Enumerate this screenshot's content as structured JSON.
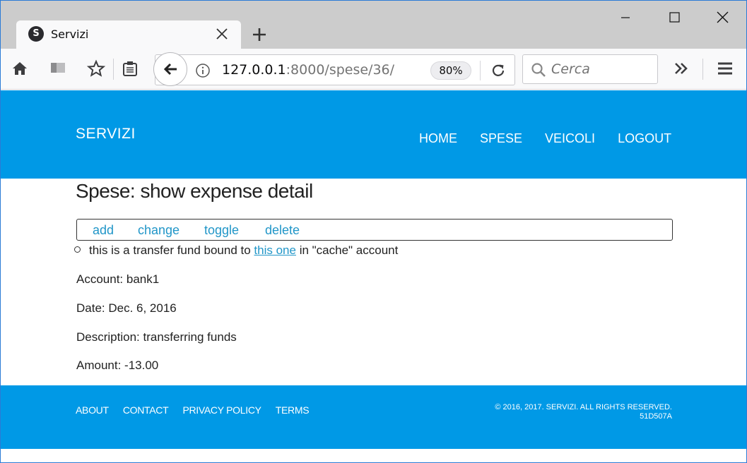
{
  "browser": {
    "tab_title": "Servizi",
    "favicon_letter": "S",
    "url_host": "127.0.0.1",
    "url_rest": ":8000/spese/36/",
    "zoom": "80%",
    "search_placeholder": "Cerca",
    "icons": [
      "home-icon",
      "pocket-icon",
      "bookmark-star-icon",
      "reader-icon",
      "back-arrow-icon",
      "info-icon",
      "reload-icon",
      "search-icon",
      "overflow-icon",
      "hamburger-menu-icon"
    ]
  },
  "header": {
    "brand": "SERVIZI",
    "nav": [
      "HOME",
      "SPESE",
      "VEICOLI",
      "LOGOUT"
    ],
    "color": "#0099e6"
  },
  "main": {
    "title": "Spese: show expense detail",
    "actions": [
      "add",
      "change",
      "toggle",
      "delete"
    ],
    "note_prefix": "this is a transfer fund bound to ",
    "note_link": "this one",
    "note_suffix": " in \"cache\" account",
    "fields": [
      "Account: bank1",
      "Date: Dec. 6, 2016",
      "Description: transferring funds",
      "Amount: -13.00"
    ]
  },
  "footer": {
    "links": [
      "ABOUT",
      "CONTACT",
      "PRIVACY POLICY",
      "TERMS"
    ],
    "copyright": "© 2016, 2017. SERVIZI. ALL RIGHTS RESERVED. 51D507A"
  }
}
